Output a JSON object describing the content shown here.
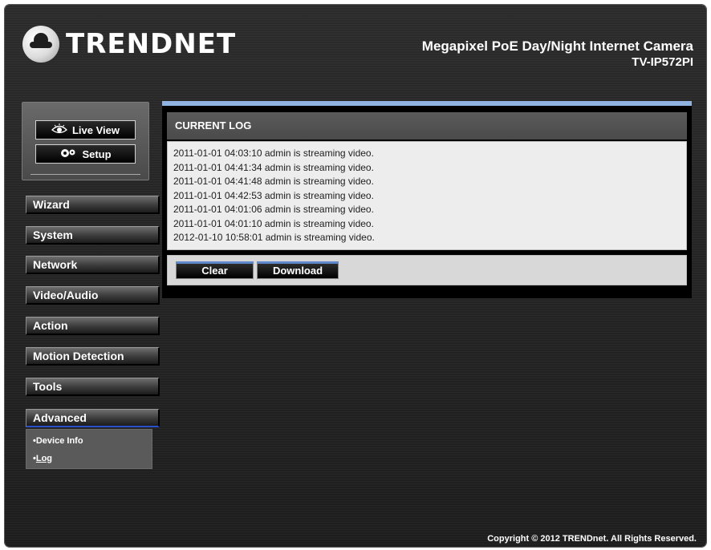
{
  "header": {
    "brand": "TRENDNET",
    "product_title": "Megapixel PoE Day/Night Internet Camera",
    "product_model": "TV-IP572PI"
  },
  "top_buttons": {
    "live_view": "Live View",
    "setup": "Setup",
    "live_view_icon": "eye-icon",
    "setup_icon": "gears-icon"
  },
  "nav": {
    "items": [
      {
        "label": "Wizard"
      },
      {
        "label": "System"
      },
      {
        "label": "Network"
      },
      {
        "label": "Video/Audio"
      },
      {
        "label": "Action"
      },
      {
        "label": "Motion Detection"
      },
      {
        "label": "Tools"
      },
      {
        "label": "Advanced"
      }
    ],
    "active": "Advanced",
    "sub_items": [
      {
        "label": "Device Info"
      },
      {
        "label": "Log"
      }
    ],
    "active_sub": "Log"
  },
  "log": {
    "title": "CURRENT LOG",
    "entries": [
      "2011-01-01 04:03:10  admin is streaming video.",
      "2011-01-01 04:41:34  admin is streaming video.",
      "2011-01-01 04:41:48  admin is streaming video.",
      "2011-01-01 04:42:53  admin is streaming video.",
      "2011-01-01 04:01:06  admin is streaming video.",
      "2011-01-01 04:01:10  admin is streaming video.",
      "2012-01-10 10:58:01  admin is streaming video."
    ],
    "clear_label": "Clear",
    "download_label": "Download"
  },
  "footer": {
    "copyright": "Copyright © 2012 TRENDnet. All Rights Reserved."
  },
  "colors": {
    "accent_blue": "#8fb2e0",
    "active_underline": "#2b4fc9",
    "background": "#242424"
  }
}
